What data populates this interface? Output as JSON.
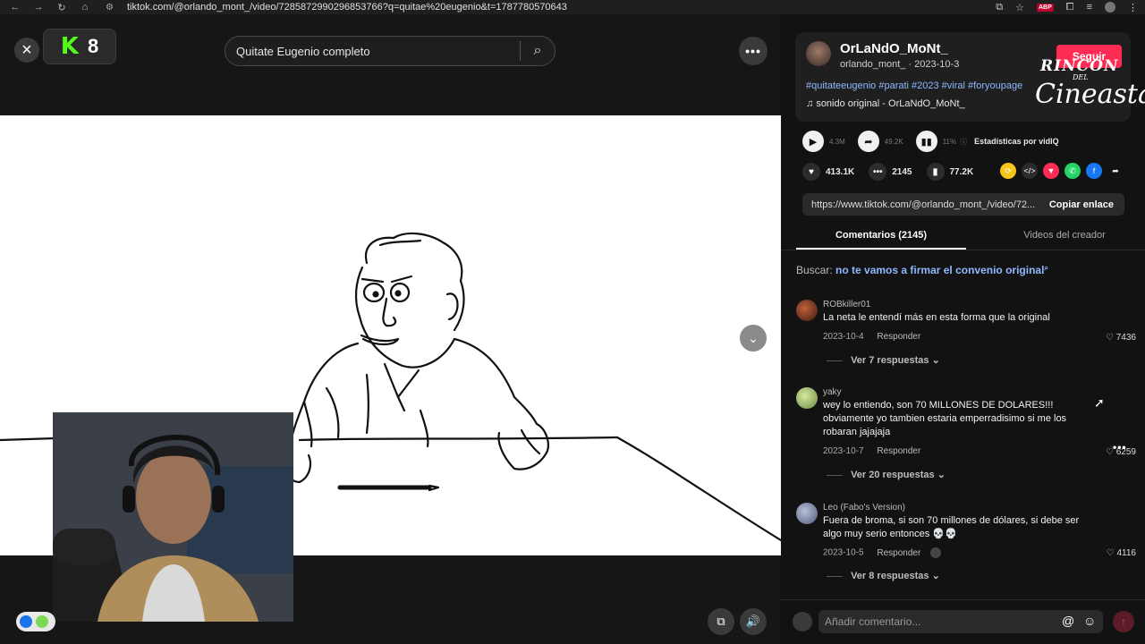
{
  "browser": {
    "url": "tiktok.com/@orlando_mont_/video/7285872990296853766?q=quitae%20eugenio&t=1787780570643",
    "abp_label": "ABP"
  },
  "player": {
    "search_text": "Quitate Eugenio completo",
    "kick_count": "8"
  },
  "post": {
    "author": "OrLaNdO_MoNt_",
    "handle_date": "orlando_mont_ · 2023-10-3",
    "follow_label": "Seguir",
    "hashtags": "#quitateeugenio #parati #2023 #viral #foryoupage",
    "sound": "sonido original - OrLaNdO_MoNt_",
    "watermark_line1": "RINCÓN",
    "watermark_line2": "DEL",
    "watermark_line3": "Cineasta"
  },
  "stats": {
    "plays": "4.3M",
    "shares": "49.2K",
    "percent": "11%",
    "stats_label": "Estadísticas por vidIQ"
  },
  "actions": {
    "likes": "413.1K",
    "comments": "2145",
    "saves": "77.2K"
  },
  "link": {
    "url": "https://www.tiktok.com/@orlando_mont_/video/72...",
    "copy_label": "Copiar enlace"
  },
  "tabs": {
    "comments": "Comentarios (2145)",
    "creator_videos": "Videos del creador"
  },
  "search_suggestion": {
    "prefix": "Buscar:",
    "query": "no te vamos a firmar el convenio original"
  },
  "comments": [
    {
      "user": "ROBkiller01",
      "text": "La neta le entendí más en esta forma que la original",
      "date": "2023-10-4",
      "reply_label": "Responder",
      "likes": "7436",
      "replies": "Ver 7 respuestas"
    },
    {
      "user": "yaky",
      "text": "wey lo entiendo, son 70 MILLONES DE DOLARES!!! obviamente yo tambien estaria emperradisimo si me los robaran jajajaja",
      "date": "2023-10-7",
      "reply_label": "Responder",
      "likes": "6259",
      "replies": "Ver 20 respuestas"
    },
    {
      "user": "Leo (Fabo's Version)",
      "text": "Fuera de broma, si son 70 millones de dólares, si debe ser algo muy serio entonces 💀💀",
      "date": "2023-10-5",
      "reply_label": "Responder",
      "likes": "4116",
      "replies": "Ver 8 respuestas"
    }
  ],
  "comment_input": {
    "placeholder": "Añadir comentario..."
  },
  "colors": {
    "accent": "#fe2c55",
    "link": "#8fb8ff",
    "kick_green": "#53fc18"
  }
}
